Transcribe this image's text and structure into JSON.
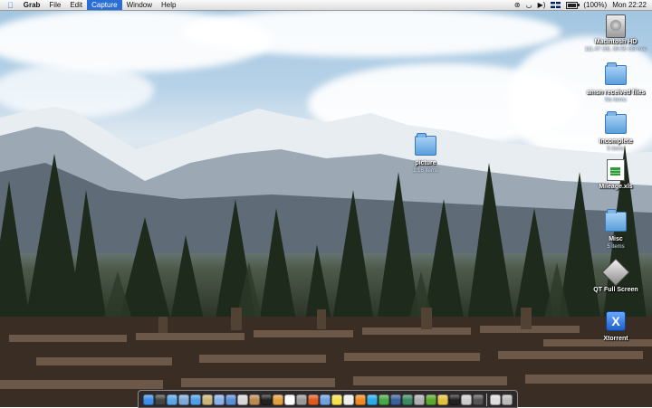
{
  "menubar": {
    "apple_icon": "apple-icon",
    "app_name": "Grab",
    "items": [
      "File",
      "Edit",
      "Capture",
      "Window",
      "Help"
    ],
    "active_item": "Capture",
    "status": {
      "icons": [
        "bluetooth-icon",
        "wifi-icon",
        "volume-icon",
        "uk-flag-icon",
        "battery-icon"
      ],
      "battery_percent": "(100%)",
      "battery_level": 1.0,
      "clock": "Mon 22:22"
    }
  },
  "desktop": {
    "icons": [
      {
        "name": "macintosh-hd",
        "kind": "hard-drive",
        "label": "Macintosh HD",
        "sub": "111.47 GB, 89.56 GB free"
      },
      {
        "name": "amsn-received-files",
        "kind": "folder",
        "label": "amsn received files",
        "sub": "No items"
      },
      {
        "name": "incomplete",
        "kind": "folder",
        "label": "Incomplete",
        "sub": "5 items"
      },
      {
        "name": "mileage-xls",
        "kind": "spreadsheet",
        "label": "Mileage.xls",
        "sub": ""
      },
      {
        "name": "misc",
        "kind": "folder",
        "label": "Misc",
        "sub": "5 items"
      },
      {
        "name": "qt-full-screen",
        "kind": "app",
        "label": "QT Full Screen",
        "sub": ""
      },
      {
        "name": "xtorrent",
        "kind": "app",
        "label": "Xtorrent",
        "sub": ""
      },
      {
        "name": "picture",
        "kind": "folder",
        "label": "picture",
        "sub": "1.16 items"
      }
    ]
  },
  "dock": {
    "apps": [
      {
        "name": "finder",
        "color": "#3c8ee8"
      },
      {
        "name": "dashboard",
        "color": "#444444"
      },
      {
        "name": "safari",
        "color": "#5aa5e8"
      },
      {
        "name": "mail",
        "color": "#7fa8d8"
      },
      {
        "name": "ichat",
        "color": "#4f9fe8"
      },
      {
        "name": "address-book",
        "color": "#c9b37a"
      },
      {
        "name": "itunes",
        "color": "#8ab0e8"
      },
      {
        "name": "iphoto",
        "color": "#5b8fd6"
      },
      {
        "name": "preview",
        "color": "#d6d6d6"
      },
      {
        "name": "imovie",
        "color": "#bb8a50"
      },
      {
        "name": "dvd-player",
        "color": "#222222"
      },
      {
        "name": "garageband",
        "color": "#e0a040"
      },
      {
        "name": "ical",
        "color": "#ffffff"
      },
      {
        "name": "system-preferences",
        "color": "#999999"
      },
      {
        "name": "firefox",
        "color": "#e05a20"
      },
      {
        "name": "quicktime",
        "color": "#6fa0e0"
      },
      {
        "name": "stickies",
        "color": "#f5e050"
      },
      {
        "name": "textedit",
        "color": "#eeeeee"
      },
      {
        "name": "vlc",
        "color": "#f08a20"
      },
      {
        "name": "skype",
        "color": "#2aa9e8"
      },
      {
        "name": "adium",
        "color": "#48a848"
      },
      {
        "name": "photoshop",
        "color": "#3a5f9a"
      },
      {
        "name": "dreamweaver",
        "color": "#3a8a60"
      },
      {
        "name": "automator",
        "color": "#b0b0b0"
      },
      {
        "name": "utorrent",
        "color": "#5aa830"
      },
      {
        "name": "ftp-client",
        "color": "#e0c040"
      },
      {
        "name": "terminal",
        "color": "#222222"
      },
      {
        "name": "grab",
        "color": "#cccccc"
      },
      {
        "name": "activity-monitor",
        "color": "#555555"
      }
    ],
    "docs": [
      {
        "name": "documents-stack",
        "color": "#dddddd"
      },
      {
        "name": "trash",
        "color": "#bbbbbb"
      }
    ]
  }
}
